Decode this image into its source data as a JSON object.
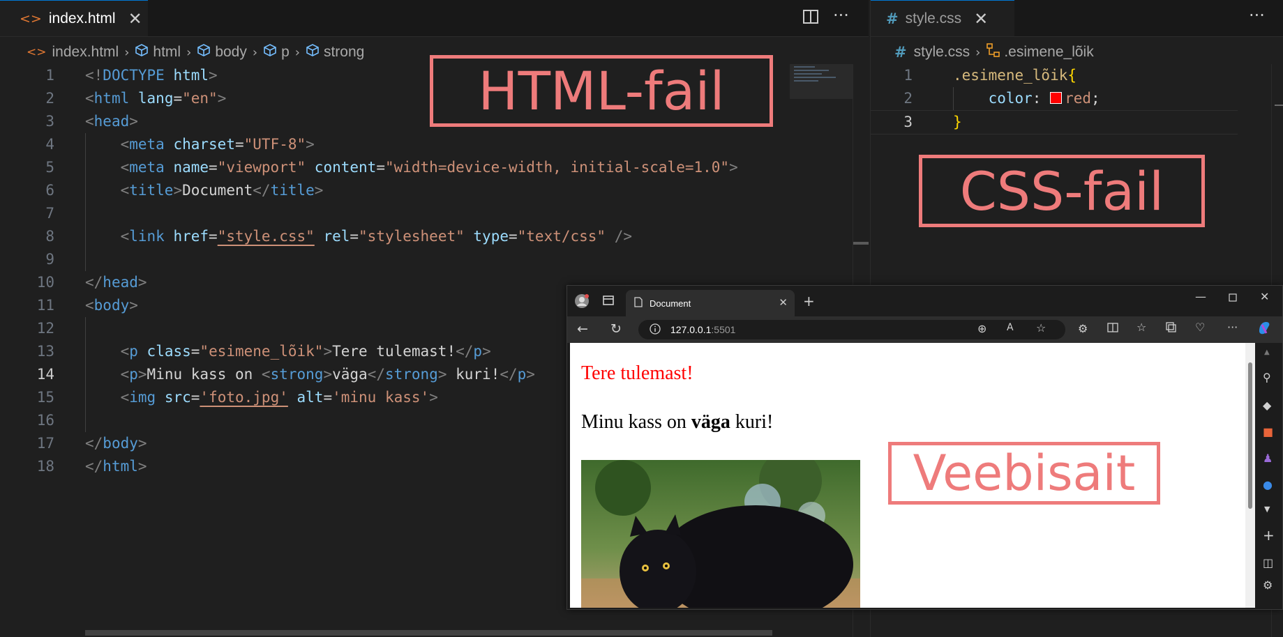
{
  "left_editor": {
    "tab": {
      "label": "index.html",
      "icon": "html-file-icon"
    },
    "toolbar": {
      "split_icon": "split-editor-icon",
      "more_icon": "more-actions-icon"
    },
    "breadcrumb": [
      "index.html",
      "html",
      "body",
      "p",
      "strong"
    ],
    "annotation": "HTML-fail",
    "line_numbers": [
      "1",
      "2",
      "3",
      "4",
      "5",
      "6",
      "7",
      "8",
      "9",
      "10",
      "11",
      "12",
      "13",
      "14",
      "15",
      "16",
      "17",
      "18"
    ],
    "current_line": "14"
  },
  "right_editor": {
    "tab": {
      "label": "style.css",
      "icon": "css-file-icon"
    },
    "breadcrumb": [
      "style.css",
      ".esimene_lõik"
    ],
    "annotation": "CSS-fail",
    "line_numbers": [
      "1",
      "2",
      "3"
    ],
    "swatch_color": "#ff0000"
  },
  "browser": {
    "tab_title": "Document",
    "url_host": "127.0.0.1",
    "url_port": ":5501",
    "page": {
      "paragraph_red": "Tere tulemast!",
      "paragraph_text_before": "Minu kass on ",
      "paragraph_bold": "väga",
      "paragraph_text_after": " kuri!",
      "image_alt": "minu kass"
    },
    "annotation": "Veebisait"
  },
  "colors": {
    "editor_bg": "#1f1f1f",
    "tag": "#569cd6",
    "attribute": "#9cdcfe",
    "string": "#ce9178",
    "annotation": "#ee7b7b",
    "red_text": "#ff0000"
  }
}
